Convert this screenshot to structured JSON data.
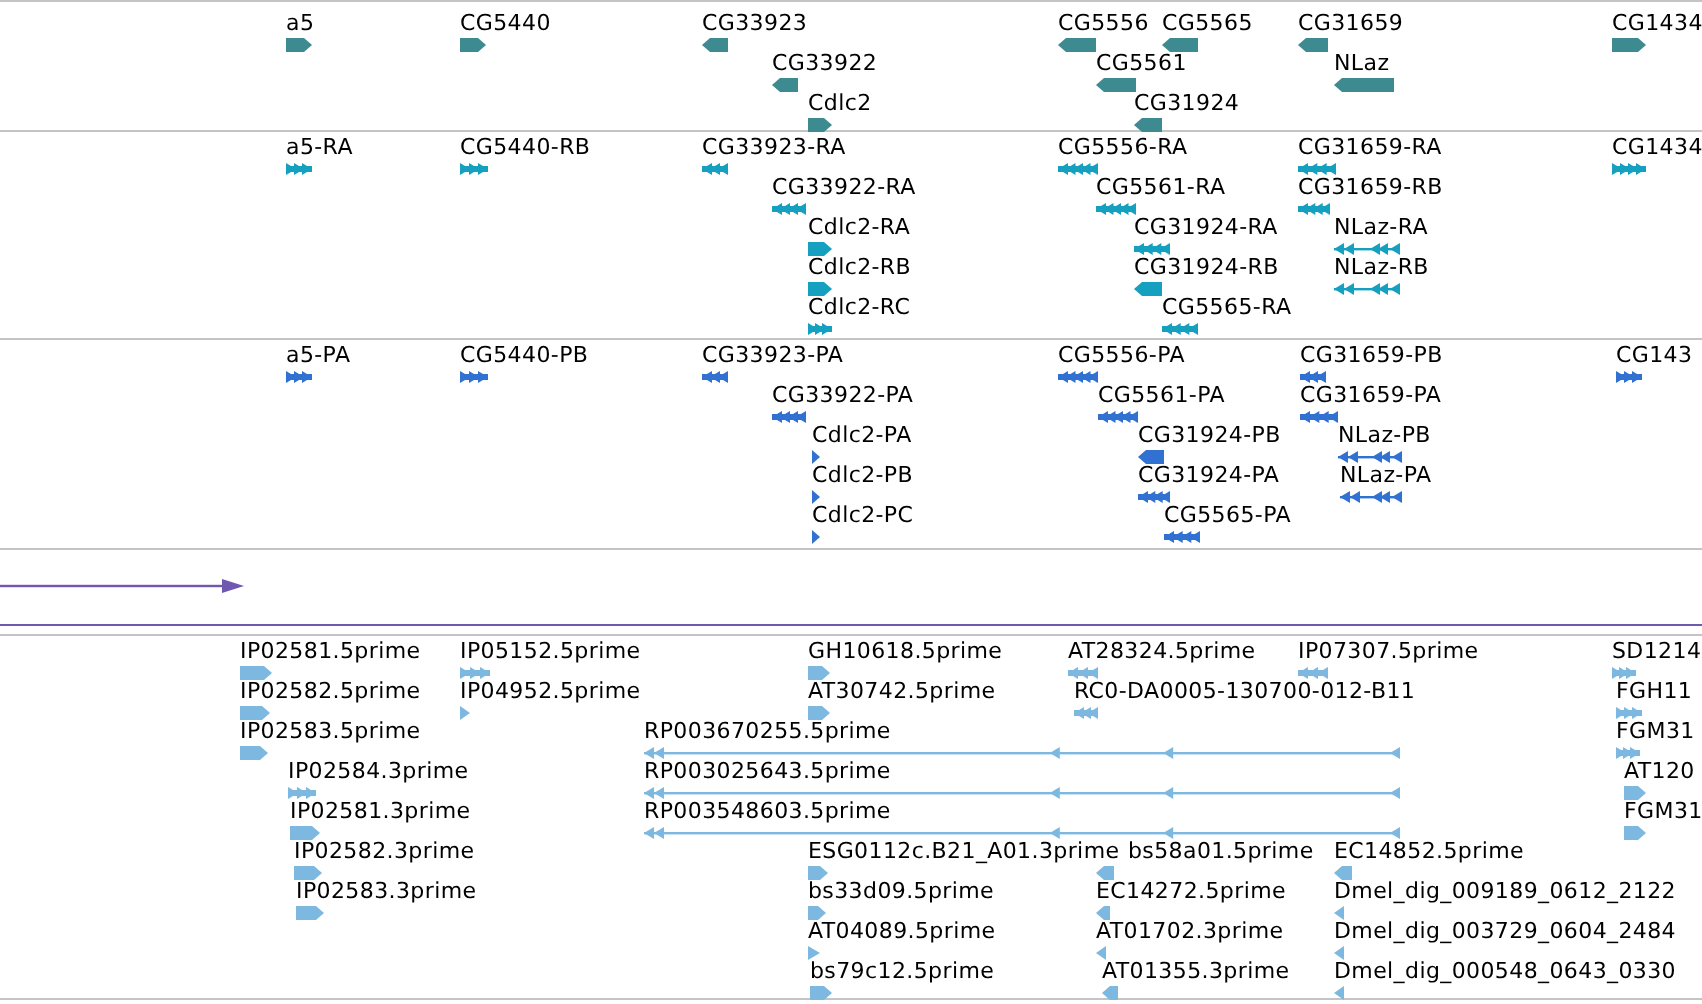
{
  "tracks": [
    {
      "kind": "features",
      "color": "#3e8a91",
      "features": [
        {
          "label": "a5",
          "reverse": false,
          "kind": "block"
        },
        {
          "label": "CG5440",
          "reverse": false,
          "kind": "block"
        },
        {
          "label": "CG33923",
          "reverse": true,
          "kind": "block"
        },
        {
          "label": "CG33922",
          "reverse": true,
          "kind": "block"
        },
        {
          "label": "Cdlc2",
          "reverse": false,
          "kind": "block"
        },
        {
          "label": "CG5556",
          "reverse": true,
          "kind": "block"
        },
        {
          "label": "CG5565",
          "reverse": true,
          "kind": "block"
        },
        {
          "label": "CG5561",
          "reverse": true,
          "kind": "block"
        },
        {
          "label": "CG31924",
          "reverse": true,
          "kind": "block"
        },
        {
          "label": "CG31659",
          "reverse": true,
          "kind": "block"
        },
        {
          "label": "NLaz",
          "reverse": true,
          "kind": "block"
        },
        {
          "label": "CG1434",
          "reverse": false,
          "kind": "block"
        }
      ]
    },
    {
      "kind": "features",
      "color": "#15a0bf",
      "features": [
        {
          "label": "a5-RA",
          "reverse": false,
          "kind": "exons"
        },
        {
          "label": "CG5440-RB",
          "reverse": false,
          "kind": "exons"
        },
        {
          "label": "CG33923-RA",
          "reverse": true,
          "kind": "exons"
        },
        {
          "label": "CG33922-RA",
          "reverse": true,
          "kind": "exons"
        },
        {
          "label": "Cdlc2-RA",
          "reverse": false,
          "kind": "block"
        },
        {
          "label": "Cdlc2-RB",
          "reverse": false,
          "kind": "block"
        },
        {
          "label": "Cdlc2-RC",
          "reverse": false,
          "kind": "exons"
        },
        {
          "label": "CG5556-RA",
          "reverse": true,
          "kind": "exons"
        },
        {
          "label": "CG5561-RA",
          "reverse": true,
          "kind": "exons"
        },
        {
          "label": "CG31924-RA",
          "reverse": true,
          "kind": "exons"
        },
        {
          "label": "CG31924-RB",
          "reverse": true,
          "kind": "block"
        },
        {
          "label": "CG5565-RA",
          "reverse": true,
          "kind": "exons"
        },
        {
          "label": "CG31659-RA",
          "reverse": true,
          "kind": "exons"
        },
        {
          "label": "CG31659-RB",
          "reverse": true,
          "kind": "exons"
        },
        {
          "label": "NLaz-RA",
          "reverse": true,
          "kind": "spliced"
        },
        {
          "label": "NLaz-RB",
          "reverse": true,
          "kind": "spliced"
        },
        {
          "label": "CG1434",
          "reverse": false,
          "kind": "exons"
        }
      ]
    },
    {
      "kind": "features",
      "color": "#3171d1",
      "features": [
        {
          "label": "a5-PA",
          "reverse": false,
          "kind": "exons"
        },
        {
          "label": "CG5440-PB",
          "reverse": false,
          "kind": "exons"
        },
        {
          "label": "CG33923-PA",
          "reverse": true,
          "kind": "exons"
        },
        {
          "label": "CG33922-PA",
          "reverse": true,
          "kind": "exons"
        },
        {
          "label": "Cdlc2-PA",
          "reverse": false,
          "kind": "block"
        },
        {
          "label": "Cdlc2-PB",
          "reverse": false,
          "kind": "block"
        },
        {
          "label": "Cdlc2-PC",
          "reverse": false,
          "kind": "block"
        },
        {
          "label": "CG5556-PA",
          "reverse": true,
          "kind": "exons"
        },
        {
          "label": "CG5561-PA",
          "reverse": true,
          "kind": "exons"
        },
        {
          "label": "CG31924-PB",
          "reverse": true,
          "kind": "block"
        },
        {
          "label": "CG31924-PA",
          "reverse": true,
          "kind": "exons"
        },
        {
          "label": "CG5565-PA",
          "reverse": true,
          "kind": "exons"
        },
        {
          "label": "CG31659-PB",
          "reverse": true,
          "kind": "exons"
        },
        {
          "label": "CG31659-PA",
          "reverse": true,
          "kind": "exons"
        },
        {
          "label": "NLaz-PB",
          "reverse": true,
          "kind": "spliced"
        },
        {
          "label": "NLaz-PA",
          "reverse": true,
          "kind": "spliced"
        },
        {
          "label": "CG143",
          "reverse": false,
          "kind": "exons"
        }
      ]
    },
    {
      "kind": "arrow",
      "color": "#7057b0"
    },
    {
      "kind": "features",
      "color": "#7db8e0",
      "features": [
        {
          "label": "IP02581.5prime",
          "reverse": false,
          "kind": "block"
        },
        {
          "label": "IP05152.5prime",
          "reverse": false,
          "kind": "exons"
        },
        {
          "label": "GH10618.5prime",
          "reverse": false,
          "kind": "block"
        },
        {
          "label": "AT28324.5prime",
          "reverse": true,
          "kind": "exons"
        },
        {
          "label": "IP07307.5prime",
          "reverse": true,
          "kind": "exons"
        },
        {
          "label": "SD1214",
          "reverse": false,
          "kind": "exons"
        },
        {
          "label": "IP02582.5prime",
          "reverse": false,
          "kind": "block"
        },
        {
          "label": "IP04952.5prime",
          "reverse": false,
          "kind": "block"
        },
        {
          "label": "AT30742.5prime",
          "reverse": false,
          "kind": "block"
        },
        {
          "label": "RC0-DA0005-130700-012-B11",
          "reverse": true,
          "kind": "exons"
        },
        {
          "label": "FGH11",
          "reverse": false,
          "kind": "exons"
        },
        {
          "label": "IP02583.5prime",
          "reverse": false,
          "kind": "block"
        },
        {
          "label": "RP003670255.5prime",
          "reverse": true,
          "kind": "spliced"
        },
        {
          "label": "FGM31",
          "reverse": false,
          "kind": "exons"
        },
        {
          "label": "IP02584.3prime",
          "reverse": false,
          "kind": "exons"
        },
        {
          "label": "RP003025643.5prime",
          "reverse": true,
          "kind": "spliced"
        },
        {
          "label": "AT120",
          "reverse": false,
          "kind": "block"
        },
        {
          "label": "IP02581.3prime",
          "reverse": false,
          "kind": "block"
        },
        {
          "label": "RP003548603.5prime",
          "reverse": true,
          "kind": "spliced"
        },
        {
          "label": "FGM31",
          "reverse": false,
          "kind": "block"
        },
        {
          "label": "IP02582.3prime",
          "reverse": false,
          "kind": "block"
        },
        {
          "label": "ESG0112c.B21_A01.3prime",
          "reverse": false,
          "kind": "block"
        },
        {
          "label": "bs58a01.5prime",
          "reverse": true,
          "kind": "block"
        },
        {
          "label": "EC14852.5prime",
          "reverse": true,
          "kind": "block"
        },
        {
          "label": "IP02583.3prime",
          "reverse": false,
          "kind": "block"
        },
        {
          "label": "bs33d09.5prime",
          "reverse": false,
          "kind": "block"
        },
        {
          "label": "EC14272.5prime",
          "reverse": true,
          "kind": "block"
        },
        {
          "label": "Dmel_dig_009189_0612_2122",
          "reverse": true,
          "kind": "block"
        },
        {
          "label": "AT04089.5prime",
          "reverse": false,
          "kind": "block"
        },
        {
          "label": "AT01702.3prime",
          "reverse": true,
          "kind": "block"
        },
        {
          "label": "Dmel_dig_003729_0604_2484",
          "reverse": true,
          "kind": "block"
        },
        {
          "label": "bs79c12.5prime",
          "reverse": false,
          "kind": "block"
        },
        {
          "label": "AT01355.3prime",
          "reverse": true,
          "kind": "block"
        },
        {
          "label": "Dmel_dig_000548_0643_0330",
          "reverse": true,
          "kind": "block"
        }
      ]
    }
  ]
}
